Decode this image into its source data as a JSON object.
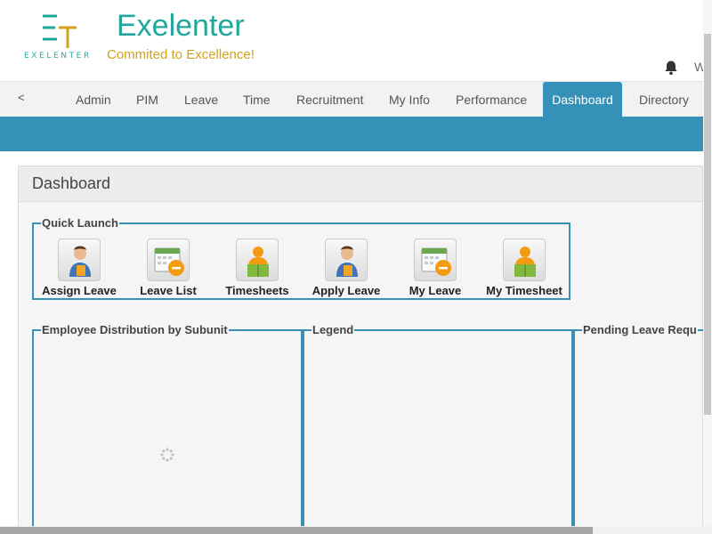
{
  "header": {
    "logo_letters": "ET",
    "logo_subtext": "EXELENTER",
    "brand_name": "Exelenter",
    "tagline": "Commited to Excellence!",
    "welcome_text": "W"
  },
  "nav": {
    "back_label": "<",
    "items": [
      {
        "label": "Admin"
      },
      {
        "label": "PIM"
      },
      {
        "label": "Leave"
      },
      {
        "label": "Time"
      },
      {
        "label": "Recruitment"
      },
      {
        "label": "My Info"
      },
      {
        "label": "Performance"
      },
      {
        "label": "Dashboard",
        "active": true
      },
      {
        "label": "Directory"
      }
    ]
  },
  "colors": {
    "accent": "#3691b9",
    "brand": "#1fa79c",
    "tagline": "#d2a21d"
  },
  "dashboard": {
    "title": "Dashboard",
    "quick_launch": {
      "legend": "Quick Launch",
      "items": [
        {
          "label": "Assign Leave",
          "icon": "person-assign-icon"
        },
        {
          "label": "Leave List",
          "icon": "calendar-list-icon"
        },
        {
          "label": "Timesheets",
          "icon": "person-timesheet-icon"
        },
        {
          "label": "Apply Leave",
          "icon": "person-apply-icon"
        },
        {
          "label": "My Leave",
          "icon": "calendar-my-leave-icon"
        },
        {
          "label": "My Timesheet",
          "icon": "person-timesheet-icon"
        }
      ]
    },
    "widgets": [
      {
        "legend": "Employee Distribution by Subunit"
      },
      {
        "legend": "Legend"
      },
      {
        "legend": "Pending Leave Requ"
      }
    ]
  }
}
